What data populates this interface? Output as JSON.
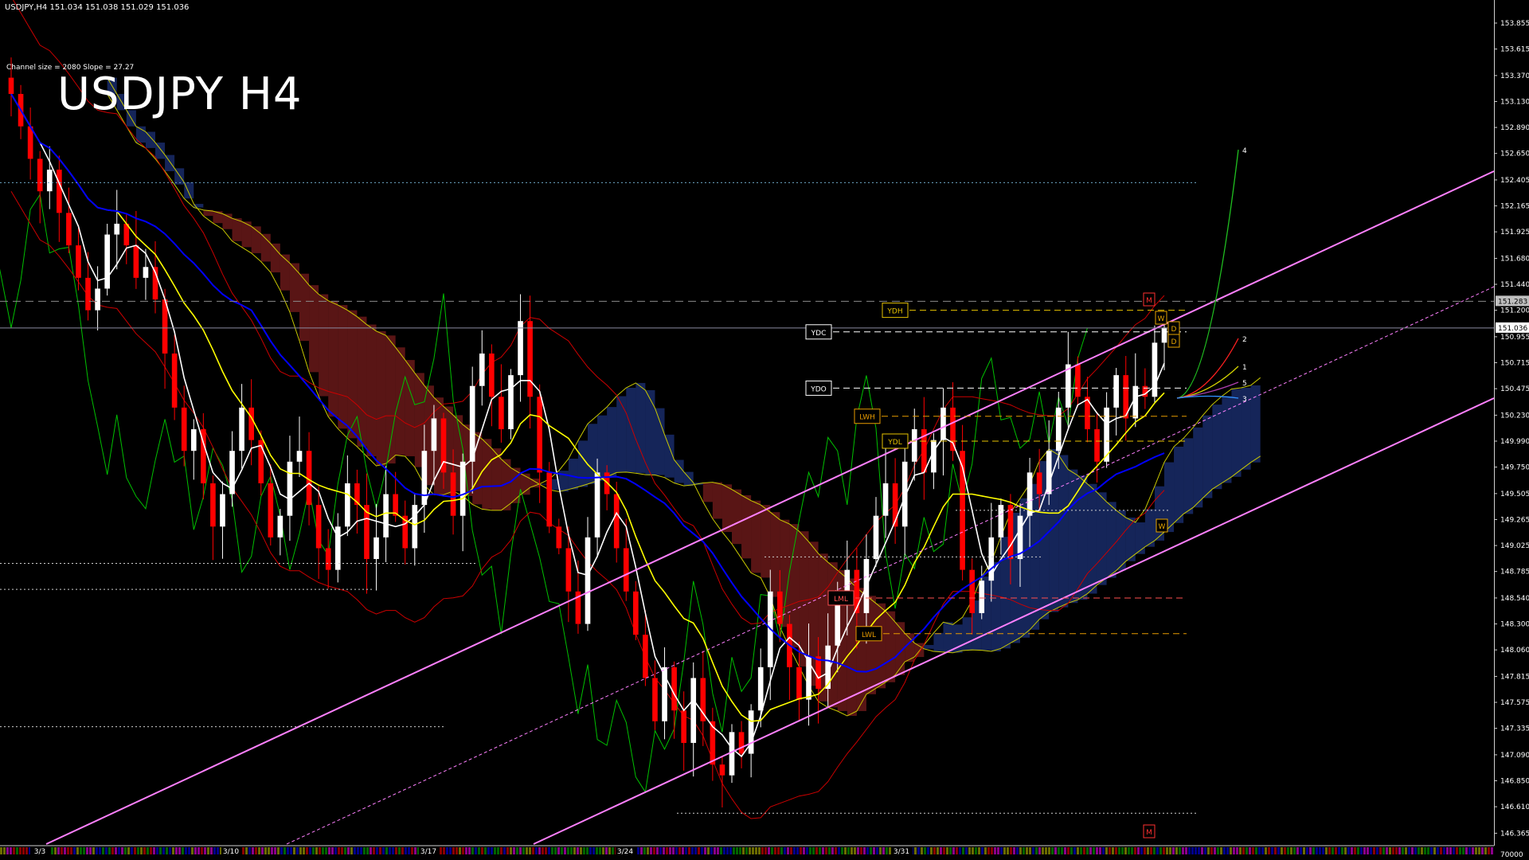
{
  "header": {
    "info": "USDJPY,H4  151.034 151.038 151.029 151.036",
    "channel": "Channel size = 2080 Slope = 27.27",
    "title": "USDJPY H4"
  },
  "colors": {
    "background": "#000000",
    "bull": "#ffffff",
    "bear": "#ff0000",
    "ma_white": "#ffffff",
    "ma_yellow": "#ffff00",
    "ma_blue": "#0000ff",
    "channel": "#ff80ff",
    "kumo_red": "#ff3b3b",
    "kumo_blue": "#3b6bff",
    "span_yellow": "#c8c800",
    "chikou": "#00c000",
    "bollinger": "#cc0000",
    "price_tag_bg": "#ffffff",
    "ask_tag_bg": "#bfbfbf"
  },
  "price_tags": {
    "current": "151.036",
    "ask_line": "151.283"
  },
  "level_tags": [
    "YDH",
    "YDC",
    "YDO",
    "LWH",
    "YDL",
    "LWL",
    "LML",
    "W",
    "D",
    "D",
    "M",
    "M",
    "W"
  ],
  "projection_labels": [
    "4",
    "2",
    "1",
    "5",
    "3"
  ],
  "bottom_labels": [
    "70000"
  ],
  "chart_data": {
    "type": "candlestick",
    "title": "USDJPY H4",
    "symbol": "USDJPY",
    "timeframe": "H4",
    "x_labels": [
      "3/3",
      "3/10",
      "3/17",
      "3/24",
      "3/31"
    ],
    "y_ticks": [
      "153.855",
      "153.615",
      "153.370",
      "153.130",
      "152.890",
      "152.650",
      "152.405",
      "152.165",
      "151.925",
      "151.680",
      "151.440",
      "151.200",
      "150.955",
      "150.715",
      "150.475",
      "150.230",
      "149.990",
      "149.750",
      "149.505",
      "149.265",
      "149.025",
      "148.785",
      "148.540",
      "148.300",
      "148.060",
      "147.815",
      "147.575",
      "147.335",
      "147.090",
      "146.850",
      "146.610",
      "146.365"
    ],
    "ylim": [
      146.25,
      153.98
    ],
    "last": {
      "open": 151.034,
      "high": 151.038,
      "low": 151.029,
      "close": 151.036
    },
    "closes": [
      153.2,
      152.9,
      152.6,
      152.3,
      152.5,
      152.1,
      151.8,
      151.5,
      151.2,
      151.4,
      151.9,
      152.0,
      151.8,
      151.5,
      151.6,
      151.3,
      150.8,
      150.3,
      149.9,
      150.1,
      149.6,
      149.2,
      149.5,
      149.9,
      150.3,
      150.0,
      149.6,
      149.1,
      149.3,
      149.8,
      149.9,
      149.4,
      149.0,
      148.8,
      149.2,
      149.6,
      149.4,
      148.9,
      149.1,
      149.5,
      149.3,
      149.0,
      149.4,
      149.9,
      150.2,
      149.7,
      149.3,
      149.8,
      150.5,
      150.8,
      150.4,
      150.1,
      150.6,
      151.1,
      150.4,
      149.7,
      149.2,
      149.0,
      148.6,
      148.3,
      149.1,
      149.7,
      149.5,
      149.0,
      148.6,
      148.2,
      147.8,
      147.4,
      147.9,
      147.5,
      147.2,
      147.8,
      147.4,
      147.0,
      146.9,
      147.3,
      147.1,
      147.5,
      147.9,
      148.6,
      148.3,
      147.9,
      147.6,
      148.0,
      147.7,
      148.1,
      148.5,
      148.8,
      148.4,
      148.9,
      149.3,
      149.6,
      149.2,
      149.8,
      150.1,
      149.7,
      150.0,
      150.3,
      149.9,
      148.8,
      148.4,
      148.7,
      149.1,
      149.4,
      148.9,
      149.3,
      149.7,
      149.5,
      149.9,
      150.3,
      150.7,
      150.4,
      150.1,
      149.8,
      150.3,
      150.6,
      150.2,
      150.5,
      150.4,
      150.9,
      151.04
    ],
    "moving_averages": [
      {
        "name": "MA white",
        "color": "#ffffff"
      },
      {
        "name": "MA yellow",
        "color": "#ffff00"
      },
      {
        "name": "MA blue",
        "color": "#0000ff"
      }
    ],
    "levels": [
      {
        "label": "YDH",
        "value": 151.2
      },
      {
        "label": "YDC",
        "value": 151.0
      },
      {
        "label": "YDO",
        "value": 150.48
      },
      {
        "label": "LWH",
        "value": 150.22
      },
      {
        "label": "YDL",
        "value": 149.99
      },
      {
        "label": "LWL",
        "value": 148.21
      },
      {
        "label": "LML",
        "value": 148.54
      }
    ],
    "grid": false
  }
}
